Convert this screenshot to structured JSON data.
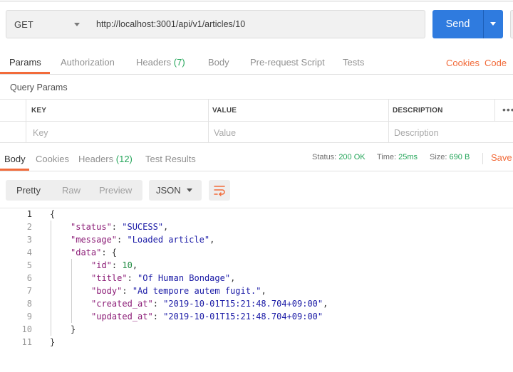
{
  "request": {
    "method": "GET",
    "url": "http://localhost:3001/api/v1/articles/10",
    "send_label": "Send"
  },
  "request_tabs": [
    {
      "label": "Params"
    },
    {
      "label": "Authorization"
    },
    {
      "label": "Headers",
      "count": "(7)"
    },
    {
      "label": "Body"
    },
    {
      "label": "Pre-request Script"
    },
    {
      "label": "Tests"
    }
  ],
  "request_links": {
    "cookies": "Cookies",
    "code": "Code"
  },
  "query_params": {
    "title": "Query Params",
    "columns": [
      "KEY",
      "VALUE",
      "DESCRIPTION"
    ],
    "placeholders": [
      "Key",
      "Value",
      "Description"
    ]
  },
  "response_tabs": [
    {
      "label": "Body"
    },
    {
      "label": "Cookies"
    },
    {
      "label": "Headers",
      "count": "(12)"
    },
    {
      "label": "Test Results"
    }
  ],
  "response_status": {
    "status_label": "Status:",
    "status_value": "200 OK",
    "time_label": "Time:",
    "time_value": "25ms",
    "size_label": "Size:",
    "size_value": "690 B",
    "save_label": "Save R"
  },
  "viewer": {
    "modes": [
      "Pretty",
      "Raw",
      "Preview"
    ],
    "format": "JSON"
  },
  "code_lines": [
    "1",
    "2",
    "3",
    "4",
    "5",
    "6",
    "7",
    "8",
    "9",
    "10",
    "11"
  ],
  "json_body": {
    "status_key": "\"status\"",
    "status_val": "\"SUCESS\"",
    "message_key": "\"message\"",
    "message_val": "\"Loaded article\"",
    "data_key": "\"data\"",
    "id_key": "\"id\"",
    "id_val": "10",
    "title_key": "\"title\"",
    "title_val": "\"Of Human Bondage\"",
    "body_key": "\"body\"",
    "body_val": "\"Ad tempore autem fugit.\"",
    "created_key": "\"created_at\"",
    "created_val": "\"2019-10-01T15:21:48.704+09:00\"",
    "updated_key": "\"updated_at\"",
    "updated_val": "\"2019-10-01T15:21:48.704+09:00\""
  },
  "colors": {
    "accent": "#f26b3a",
    "send": "#2f7bdf",
    "count_green": "#26a65b"
  },
  "icons": [
    "chevron-down-icon",
    "more-dots-icon",
    "wrap-lines-icon"
  ]
}
